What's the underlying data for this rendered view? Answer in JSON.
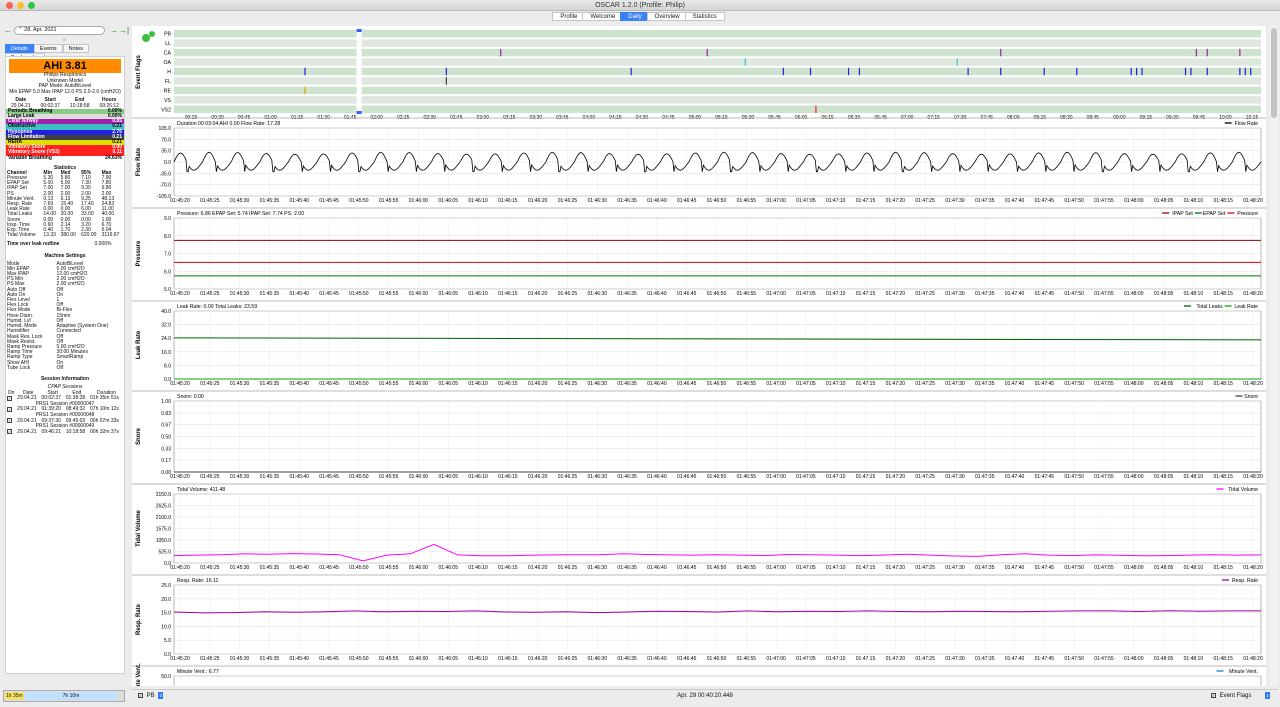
{
  "window": {
    "title": "OSCAR 1.2.0 (Profile: Philip)"
  },
  "tabs": [
    {
      "label": "Profile",
      "active": false
    },
    {
      "label": "Welcome",
      "active": false
    },
    {
      "label": "Daily",
      "active": true
    },
    {
      "label": "Overview",
      "active": false
    },
    {
      "label": "Statistics",
      "active": false
    }
  ],
  "nav": {
    "date": "28. Apr. 2021",
    "prev": "←",
    "next": "→",
    "last": "→|"
  },
  "left_tabs": [
    "Details",
    "Events",
    "Notes",
    "Bookmarks"
  ],
  "summary": {
    "ahi": "AHI 3.81",
    "brand": "Philips Respironics",
    "model": "Unknown Model",
    "pap_mode": "PAP Mode: AutoBiLevel",
    "pressure_summary": "Min EPAP 5.0 Max IPAP 12.0 PS 2.0-2.0 (cmH2O)"
  },
  "session_times": {
    "headers": [
      "Date",
      "Start",
      "End",
      "Hours"
    ],
    "row": [
      "29.04.21",
      "00:02:37",
      "10:18:58",
      "09:26:12"
    ]
  },
  "events": [
    {
      "label": "Periodic Breathing",
      "value": "0.00%",
      "bg": "#88cc88",
      "fg": "#000000"
    },
    {
      "label": "Large Leak",
      "value": "0.00%",
      "bg": "#dddddd",
      "fg": "#000000"
    },
    {
      "label": "Clear Airway",
      "value": "0.85",
      "bg": "#a020b0",
      "fg": "#ffffff"
    },
    {
      "label": "Obstructive",
      "value": "0.21",
      "bg": "#40c0c0",
      "fg": "#000000"
    },
    {
      "label": "Hypopnea",
      "value": "2.76",
      "bg": "#2020e0",
      "fg": "#ffffff"
    },
    {
      "label": "Flow Limitation",
      "value": "0.21",
      "bg": "#404040",
      "fg": "#ffffff"
    },
    {
      "label": "RERA",
      "value": "0.21",
      "bg": "#e0e000",
      "fg": "#000000"
    },
    {
      "label": "Vibratory Snore",
      "value": "0.00",
      "bg": "#ff2020",
      "fg": "#ffffff"
    },
    {
      "label": "Vibratory Snore (VS2)",
      "value": "0.11",
      "bg": "#ff2020",
      "fg": "#ffffff"
    },
    {
      "label": "Variable Breathing",
      "value": "24.63%",
      "bg": "#ffffff",
      "fg": "#000000"
    }
  ],
  "statistics": {
    "title": "Statistics",
    "headers": [
      "Channel",
      "Min",
      "Med",
      "95%",
      "Max"
    ],
    "rows": [
      [
        "Pressure",
        "5.30",
        "5.80",
        "7.10",
        "7.90"
      ],
      [
        "EPAP Set",
        "5.00",
        "5.00",
        "7.30",
        "7.80"
      ],
      [
        "IPAP Set",
        "7.00",
        "7.00",
        "9.30",
        "9.80"
      ],
      [
        "PS",
        "2.00",
        "2.00",
        "2.00",
        "2.00"
      ],
      [
        "Minute Vent.",
        "0.13",
        "6.13",
        "9.25",
        "48.13"
      ],
      [
        "Resp. Rate",
        "7.69",
        "15.40",
        "17.40",
        "24.83"
      ],
      [
        "Leak Rate",
        "0.00",
        "0.00",
        "6.00",
        "11.00"
      ],
      [
        "Total Leaks",
        "14.00",
        "20.00",
        "33.00",
        "40.00"
      ],
      [
        "Snore",
        "0.00",
        "0.00",
        "0.00",
        "1.00"
      ],
      [
        "Insp. Time",
        "0.60",
        "2.14",
        "3.20",
        "6.70"
      ],
      [
        "Exp. Time",
        "0.40",
        "1.70",
        "2.30",
        "6.04"
      ],
      [
        "Tidal Volume",
        "13.33",
        "380.00",
        "620.00",
        "3116.67"
      ]
    ],
    "over_leak_label": "Time over leak redline",
    "over_leak_value": "0.000%"
  },
  "machine": {
    "title": "Machine Settings",
    "rows": [
      [
        "Mode",
        "AutoBiLevel"
      ],
      [
        "Min EPAP",
        "5.00 cmH2O"
      ],
      [
        "Max IPAP",
        "12.00 cmH2O"
      ],
      [
        "PS Min",
        "2.00 cmH2O"
      ],
      [
        "PS Max",
        "2.00 cmH2O"
      ],
      [
        "Auto Off",
        "Off"
      ],
      [
        "Auto On",
        "On"
      ],
      [
        "Flex Level",
        "1"
      ],
      [
        "Flex Lock",
        "Off"
      ],
      [
        "Flex Mode",
        "Bi-Flex"
      ],
      [
        "Hose Diam.",
        "15mm"
      ],
      [
        "Humid. Lvl",
        "Off"
      ],
      [
        "Humid. Mode",
        "Adaptive (System One)"
      ],
      [
        "Humidifier",
        "Connected"
      ],
      [
        "Mask Res. Lock",
        "Off"
      ],
      [
        "Mask Resist.",
        "Off"
      ],
      [
        "Ramp Pressure",
        "5.00 cmH2O"
      ],
      [
        "Ramp Time",
        "30:00 Minutes"
      ],
      [
        "Ramp Type",
        "SmartRamp"
      ],
      [
        "Show AHI",
        "On"
      ],
      [
        "Tube Lock",
        "Off"
      ]
    ]
  },
  "sessions": {
    "title": "Session Information",
    "subtitle": "CPAP Sessions",
    "headers": [
      "On",
      "Date",
      "Start",
      "End",
      "Duration"
    ],
    "rows": [
      {
        "date": "29.04.21",
        "start": "00:02:37",
        "end": "01:38:28",
        "duration": "01h 35m 51s",
        "name": "PRS1 Session #00000047"
      },
      {
        "date": "29.04.21",
        "start": "01:39:20",
        "end": "08:49:32",
        "duration": "07h 10m 12s",
        "name": "PRS1 Session #00000048"
      },
      {
        "date": "29.04.21",
        "start": "09:37:30",
        "end": "09:45:03",
        "duration": "00h 07m 33s",
        "name": "PRS1 Session #00000049"
      },
      {
        "date": "29.04.21",
        "start": "09:46:21",
        "end": "10:18:58",
        "duration": "00h 32m 37s",
        "name": ""
      }
    ]
  },
  "bottom": {
    "left": "1h 35m",
    "right": "7h 10m"
  },
  "status": {
    "pb_label": "PB",
    "timestamp": "Apr. 29 00:40:20.448",
    "event_flags_label": "Event Flags"
  },
  "event_flags": {
    "ylabel": "Event Flags",
    "rows": [
      "PB",
      "LL",
      "CA",
      "OA",
      "H",
      "FL",
      "RE",
      "VS",
      "VS2"
    ],
    "ticks": [
      "00:15",
      "00:30",
      "00:45",
      "01:00",
      "01:15",
      "01:30",
      "01:45",
      "02:00",
      "02:15",
      "02:30",
      "02:45",
      "03:00",
      "03:15",
      "03:30",
      "03:45",
      "04:00",
      "04:15",
      "04:30",
      "04:45",
      "05:00",
      "05:15",
      "05:30",
      "05:45",
      "06:00",
      "06:15",
      "06:30",
      "06:45",
      "07:00",
      "07:15",
      "07:30",
      "07:45",
      "08:00",
      "08:15",
      "08:30",
      "08:45",
      "09:00",
      "09:15",
      "09:30",
      "09:45",
      "10:00",
      "10:15"
    ],
    "marks": {
      "CA": [
        0.3,
        0.49,
        0.76,
        0.94,
        0.95,
        0.98
      ],
      "OA": [
        0.525,
        0.72
      ],
      "H": [
        0.12,
        0.25,
        0.42,
        0.56,
        0.585,
        0.62,
        0.63,
        0.73,
        0.76,
        0.8,
        0.83,
        0.88,
        0.885,
        0.89,
        0.93,
        0.935,
        0.95,
        0.98,
        0.985,
        0.99
      ],
      "FL": [
        0.25
      ],
      "RE": [
        0.12
      ],
      "VS2": [
        0.59
      ]
    }
  },
  "time_ticks": [
    "01:45:20",
    "01:45:25",
    "01:45:30",
    "01:45:35",
    "01:45:40",
    "01:45:45",
    "01:45:50",
    "01:45:55",
    "01:46:00",
    "01:46:05",
    "01:46:10",
    "01:46:15",
    "01:46:20",
    "01:46:25",
    "01:46:30",
    "01:46:35",
    "01:46:40",
    "01:46:45",
    "01:46:50",
    "01:46:55",
    "01:47:00",
    "01:47:05",
    "01:47:10",
    "01:47:15",
    "01:47:20",
    "01:47:25",
    "01:47:30",
    "01:47:35",
    "01:47:40",
    "01:47:45",
    "01:47:50",
    "01:47:55",
    "01:48:00",
    "01:48:05",
    "01:48:10",
    "01:48:15",
    "01:48:20"
  ],
  "charts": [
    {
      "key": "flow",
      "ylabel": "Flow Rate",
      "header": "Duration 00:03:04 AHI 0.00 Flow Rate: 17.28",
      "legend": [
        {
          "name": "Flow Rate",
          "color": "#000000"
        }
      ],
      "yticks": [
        "105.0",
        "70.0",
        "35.0",
        "0.0",
        "-35.0",
        "-70.0",
        "-105.0"
      ],
      "ylim": [
        -105,
        105
      ]
    },
    {
      "key": "pressure",
      "ylabel": "Pressure",
      "header": "Pressure: 6.86 EPAP Set: 5.74 IPAP Set: 7.74 PS: 2.00",
      "legend": [
        {
          "name": "IPAP Set",
          "color": "#990000"
        },
        {
          "name": "EPAP Set",
          "color": "#007700"
        },
        {
          "name": "Pressure",
          "color": "#dd0000"
        }
      ],
      "yticks": [
        "9.0",
        "8.0",
        "7.0",
        "6.0",
        "5.0"
      ],
      "ylim": [
        5,
        9
      ]
    },
    {
      "key": "leak",
      "ylabel": "Leak Rate",
      "header": "Leak Rate: 0.00 Total Leaks: 23.59",
      "legend": [
        {
          "name": "Total Leaks",
          "color": "#006600"
        },
        {
          "name": "Leak Rate",
          "color": "#00aa00"
        }
      ],
      "yticks": [
        "40.0",
        "32.0",
        "24.0",
        "16.0",
        "8.0",
        "0.0"
      ],
      "ylim": [
        0,
        40
      ]
    },
    {
      "key": "snore",
      "ylabel": "Snore",
      "header": "Snore: 0.00",
      "legend": [
        {
          "name": "Snore",
          "color": "#444444"
        }
      ],
      "yticks": [
        "1.00",
        "0.83",
        "0.67",
        "0.50",
        "0.33",
        "0.17",
        "0.00"
      ],
      "ylim": [
        0,
        1
      ]
    },
    {
      "key": "tidal",
      "ylabel": "Tidal Volume",
      "header": "Tidal Volume: 411.48",
      "legend": [
        {
          "name": "Tidal Volume",
          "color": "#ff00ff"
        }
      ],
      "yticks": [
        "3150.0",
        "2625.0",
        "2100.0",
        "1575.0",
        "1050.0",
        "525.0",
        "0.0"
      ],
      "ylim": [
        0,
        3150
      ]
    },
    {
      "key": "resp",
      "ylabel": "Resp. Rate",
      "header": "Resp. Rate: 16.11",
      "legend": [
        {
          "name": "Resp. Rate",
          "color": "#a000a0"
        }
      ],
      "yticks": [
        "25.0",
        "20.0",
        "15.0",
        "10.0",
        "5.0",
        "0.0"
      ],
      "ylim": [
        0,
        25
      ]
    },
    {
      "key": "minvent",
      "ylabel": "Minute Vent.",
      "header": "Minute Vent.: 6.77",
      "legend": [
        {
          "name": "Minute Vent.",
          "color": "#2080d0"
        }
      ],
      "yticks": [
        "50.0"
      ],
      "ylim": [
        0,
        50
      ]
    }
  ],
  "chart_data": [
    {
      "type": "line",
      "title": "Flow Rate",
      "series": [
        {
          "name": "Flow Rate",
          "pattern": "periodic breathing waveform",
          "amplitude": [
            -35,
            35
          ]
        }
      ]
    },
    {
      "type": "line",
      "title": "Pressure",
      "series": [
        {
          "name": "IPAP Set",
          "values": [
            7.74
          ]
        },
        {
          "name": "EPAP Set",
          "values": [
            5.74
          ]
        },
        {
          "name": "Pressure",
          "values": [
            6.5
          ]
        }
      ]
    },
    {
      "type": "line",
      "title": "Leak Rate",
      "series": [
        {
          "name": "Total Leaks",
          "values": [
            23.59
          ]
        },
        {
          "name": "Leak Rate",
          "values": [
            0
          ]
        }
      ]
    },
    {
      "type": "line",
      "title": "Snore",
      "series": [
        {
          "name": "Snore",
          "values": [
            0
          ]
        }
      ]
    },
    {
      "type": "line",
      "title": "Tidal Volume",
      "series": [
        {
          "name": "Tidal Volume",
          "values": [
            340,
            360,
            380,
            420,
            400,
            430,
            410,
            380,
            100,
            360,
            420,
            850,
            370,
            330,
            330,
            350,
            370,
            380,
            380,
            420,
            390,
            370,
            360,
            380,
            360,
            340,
            390,
            380,
            360,
            340,
            360,
            400,
            360,
            320,
            300,
            380,
            420,
            360,
            340,
            370,
            350,
            330,
            340,
            360,
            380,
            360,
            370
          ]
        }
      ]
    },
    {
      "type": "line",
      "title": "Resp. Rate",
      "series": [
        {
          "name": "Resp. Rate",
          "values": [
            15.2,
            14.9,
            15.0,
            15.3,
            15.1,
            15.3,
            15.6,
            15.3,
            15.5,
            15.4,
            15.6,
            15.2,
            15.1,
            15.3,
            15.0,
            15.2,
            15.5,
            15.4,
            15.2,
            15.6,
            15.3,
            15.5,
            15.4,
            15.6,
            15.4,
            15.3,
            15.5,
            15.4,
            15.3,
            15.5,
            15.6,
            15.6,
            15.4,
            15.7,
            15.5,
            15.6,
            15.6
          ]
        }
      ]
    }
  ]
}
